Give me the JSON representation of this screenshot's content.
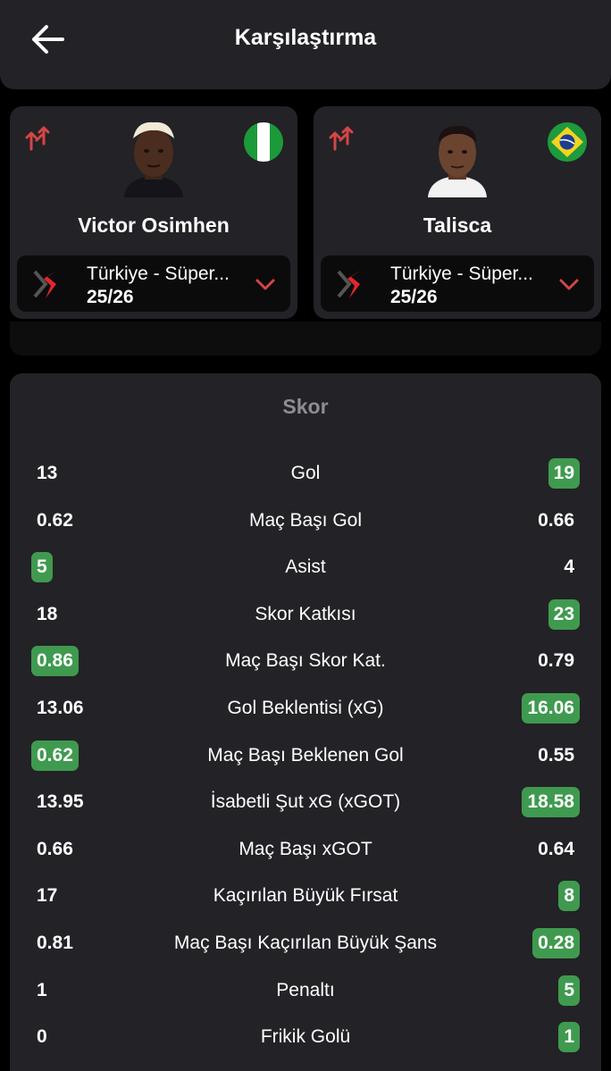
{
  "header": {
    "title": "Karşılaştırma"
  },
  "players": [
    {
      "name": "Victor Osimhen",
      "league": "Türkiye - Süper...",
      "season": "25/26",
      "flag": "nigeria-flag"
    },
    {
      "name": "Talisca",
      "league": "Türkiye - Süper...",
      "season": "25/26",
      "flag": "brazil-flag"
    }
  ],
  "colors": {
    "accent_red": "#d64545",
    "win_green": "#3f9a4f",
    "card_bg": "#232226"
  },
  "stats": {
    "section_title": "Skor",
    "rows": [
      {
        "label": "Gol",
        "left": "13",
        "right": "19",
        "winner": "right"
      },
      {
        "label": "Maç Başı Gol",
        "left": "0.62",
        "right": "0.66",
        "winner": "none"
      },
      {
        "label": "Asist",
        "left": "5",
        "right": "4",
        "winner": "left"
      },
      {
        "label": "Skor Katkısı",
        "left": "18",
        "right": "23",
        "winner": "right"
      },
      {
        "label": "Maç Başı Skor Kat.",
        "left": "0.86",
        "right": "0.79",
        "winner": "left"
      },
      {
        "label": "Gol Beklentisi (xG)",
        "left": "13.06",
        "right": "16.06",
        "winner": "right"
      },
      {
        "label": "Maç Başı Beklenen Gol",
        "left": "0.62",
        "right": "0.55",
        "winner": "left"
      },
      {
        "label": "İsabetli Şut xG (xGOT)",
        "left": "13.95",
        "right": "18.58",
        "winner": "right"
      },
      {
        "label": "Maç Başı xGOT",
        "left": "0.66",
        "right": "0.64",
        "winner": "none"
      },
      {
        "label": "Kaçırılan Büyük Fırsat",
        "left": "17",
        "right": "8",
        "winner": "right"
      },
      {
        "label": "Maç Başı Kaçırılan Büyük Şans",
        "left": "0.81",
        "right": "0.28",
        "winner": "right"
      },
      {
        "label": "Penaltı",
        "left": "1",
        "right": "5",
        "winner": "right"
      },
      {
        "label": "Frikik Golü",
        "left": "0",
        "right": "1",
        "winner": "right"
      }
    ]
  }
}
